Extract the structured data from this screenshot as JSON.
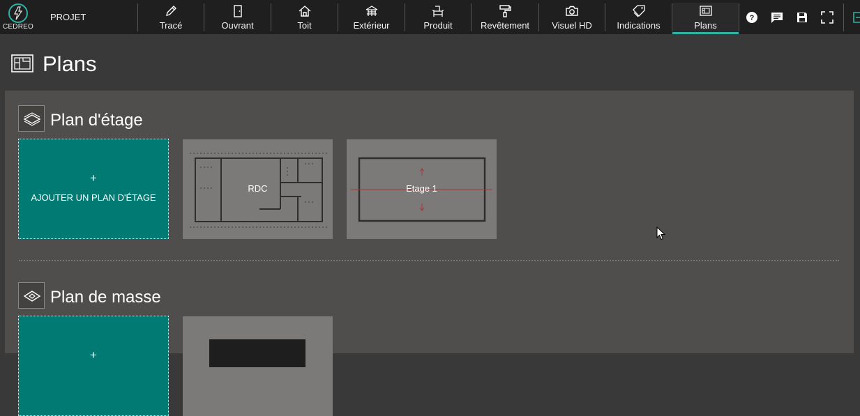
{
  "app": {
    "logo_text": "CEDREO",
    "project_label": "PROJET"
  },
  "toolbar": {
    "tools": [
      {
        "label": "Tracé",
        "icon": "pencil-icon"
      },
      {
        "label": "Ouvrant",
        "icon": "door-icon"
      },
      {
        "label": "Toit",
        "icon": "roof-icon"
      },
      {
        "label": "Extérieur",
        "icon": "terrace-icon"
      },
      {
        "label": "Produit",
        "icon": "armchair-icon"
      },
      {
        "label": "Revêtement",
        "icon": "paint-roller-icon"
      },
      {
        "label": "Visuel HD",
        "icon": "camera-icon"
      },
      {
        "label": "Indications",
        "icon": "tag-icon"
      },
      {
        "label": "Plans",
        "icon": "plans-icon"
      }
    ],
    "active_tool": "Plans",
    "utilities": [
      "help-icon",
      "comment-icon",
      "save-icon",
      "fullscreen-icon",
      "exit-icon"
    ]
  },
  "page": {
    "title": "Plans",
    "icon": "plans-icon"
  },
  "sections": {
    "floor": {
      "title": "Plan d'étage",
      "icon": "layers-icon",
      "add_plus": "+",
      "add_label": "AJOUTER UN PLAN D'ÉTAGE",
      "plans": [
        {
          "label": "RDC"
        },
        {
          "label": "Etage 1"
        }
      ]
    },
    "site": {
      "title": "Plan de masse",
      "icon": "site-plan-icon",
      "add_plus": "+"
    }
  },
  "colors": {
    "toolbar_bg": "#1f1f1f",
    "page_bg": "#3a3939",
    "panel_bg": "#504e4c",
    "accent_teal": "#007a72",
    "active_underline": "#2cb3a6",
    "thumbnail_bg": "#7b7a79"
  }
}
